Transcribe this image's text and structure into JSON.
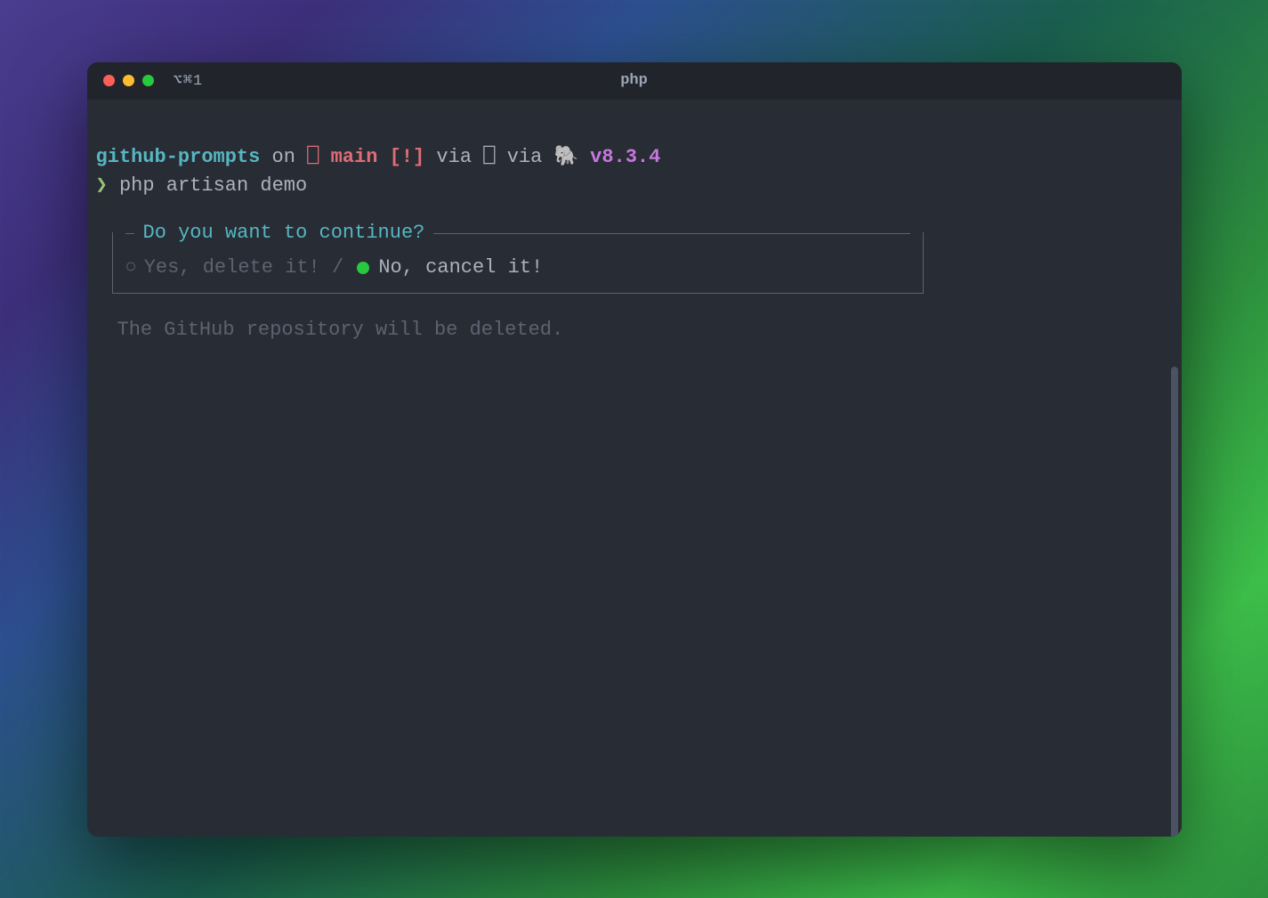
{
  "titlebar": {
    "tab_indicator": "⌥⌘1",
    "title": "php"
  },
  "prompt": {
    "cwd": "github-prompts",
    "on": " on ",
    "box1": "⎕ ",
    "branch": "main",
    "gitstatus": " [!]",
    "via1": " via ",
    "box2": "⎕ ",
    "via2": "via ",
    "elephant": "🐘",
    "version": " v8.3.4"
  },
  "command": {
    "symbol": "❯",
    "text": " php artisan demo"
  },
  "confirm": {
    "question": "Do you want to continue?",
    "options": {
      "unselected_label": "Yes, delete it!",
      "separator": " / ",
      "selected_label": "No, cancel it!"
    }
  },
  "hint": "The GitHub repository will be deleted."
}
